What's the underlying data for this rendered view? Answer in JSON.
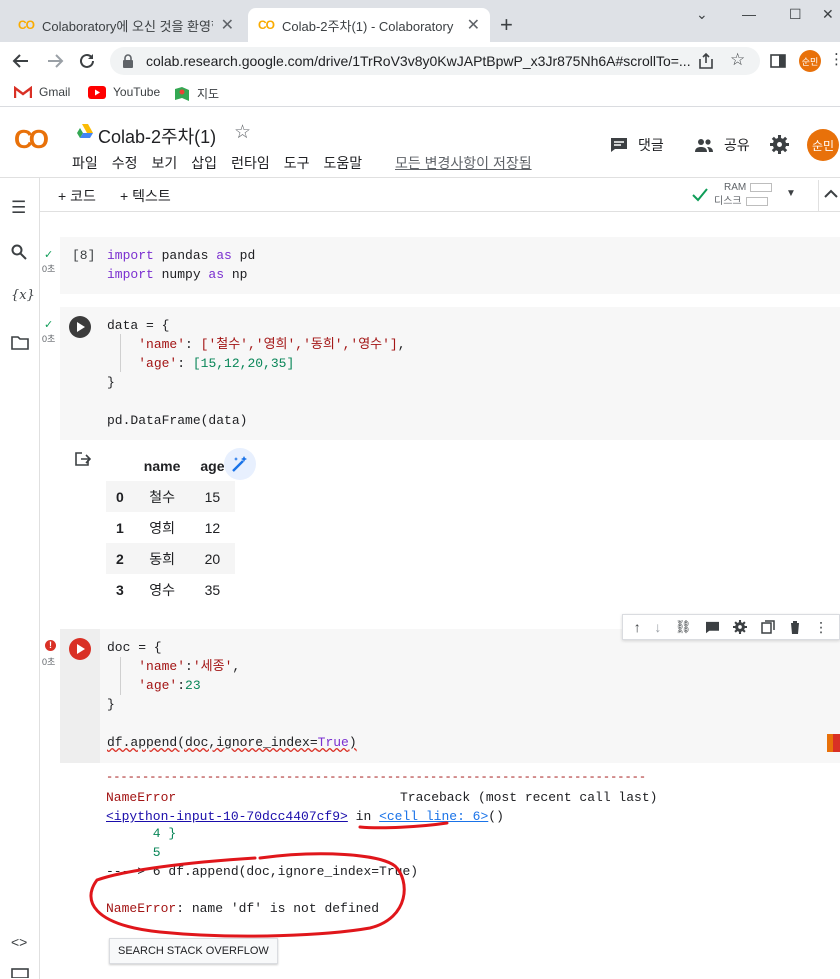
{
  "browser": {
    "tabs": [
      {
        "title": "Colaboratory에 오신 것을 환영합니다",
        "active": false
      },
      {
        "title": "Colab-2주차(1) - Colaboratory",
        "active": true
      }
    ],
    "url": "colab.research.google.com/drive/1TrRoV3v8y0KwJAPtBpwP_x3Jr875Nh6A#scrollTo=...",
    "bookmarks": [
      "Gmail",
      "YouTube",
      "지도"
    ],
    "profile_initials": "순민"
  },
  "colab": {
    "logo": "CO",
    "title": "Colab-2주차(1)",
    "menu": [
      "파일",
      "수정",
      "보기",
      "삽입",
      "런타임",
      "도구",
      "도움말"
    ],
    "saved_msg": "모든 변경사항이 저장됨",
    "comment_label": "댓글",
    "share_label": "공유",
    "avatar_initials": "순민",
    "add_code": "+ 코드",
    "add_text": "+ 텍스트",
    "ram_label": "RAM",
    "disk_label": "디스크",
    "accent": "#f9ab00"
  },
  "cells": {
    "cell1": {
      "exec_count": "[8]",
      "duration": "0초",
      "lines": [
        {
          "kw": "import",
          "rest1": " pandas ",
          "kw2": "as",
          "rest2": " pd"
        },
        {
          "kw": "import",
          "rest1": " numpy ",
          "kw2": "as",
          "rest2": " np"
        }
      ]
    },
    "cell2": {
      "duration": "0초",
      "code": {
        "l1": "data = {",
        "name_key": "'name'",
        "name_vals": "['철수','영희','동희','영수']",
        "age_key": "'age'",
        "age_vals": "[15,12,20,35]",
        "close": "}",
        "call": "pd.DataFrame(data)"
      },
      "output_table": {
        "columns": [
          "name",
          "age"
        ],
        "rows": [
          {
            "index": "0",
            "name": "철수",
            "age": "15"
          },
          {
            "index": "1",
            "name": "영희",
            "age": "12"
          },
          {
            "index": "2",
            "name": "동희",
            "age": "20"
          },
          {
            "index": "3",
            "name": "영수",
            "age": "35"
          }
        ]
      }
    },
    "cell3": {
      "duration": "0초",
      "code": {
        "l1": "doc = {",
        "name_key": "'name'",
        "name_val": "'세종'",
        "age_key": "'age'",
        "age_val": "23",
        "close": "}",
        "call_pre": "df.append(doc,ignore_index=",
        "call_true": "True",
        "call_post": ")"
      },
      "error": {
        "dashes": "---------------------------------------------------------------------------",
        "name": "NameError",
        "traceback": "Traceback (most recent call last)",
        "input_link": "<ipython-input-10-70dcc4407cf9>",
        "in_word": " in ",
        "cell_link": "<cell line: 6>",
        "cell_tail": "()",
        "l4": "      4 }",
        "l5": "      5",
        "l6": "----> 6 df.append(doc,ignore_index=True)",
        "msg_name": "NameError",
        "msg_rest": ": name 'df' is not defined",
        "so_button": "SEARCH STACK OVERFLOW"
      }
    }
  }
}
